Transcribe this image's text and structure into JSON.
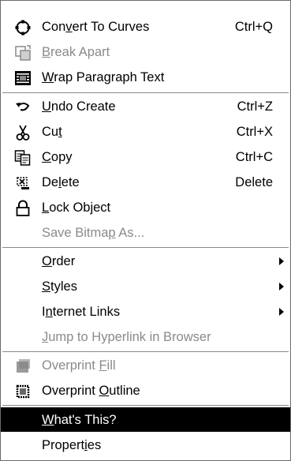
{
  "menu": {
    "items": [
      {
        "id": "convert",
        "label_pre": "Con",
        "label_u": "v",
        "label_post": "ert To Curves",
        "shortcut": "Ctrl+Q",
        "icon": "convert-curves-icon",
        "disabled": false
      },
      {
        "id": "break",
        "label_pre": "",
        "label_u": "B",
        "label_post": "reak  Apart",
        "shortcut": "",
        "icon": "break-apart-icon",
        "disabled": true
      },
      {
        "id": "wrap",
        "label_pre": "",
        "label_u": "W",
        "label_post": "rap Paragraph Text",
        "shortcut": "",
        "icon": "wrap-text-icon",
        "disabled": false
      },
      {
        "id": "undo",
        "label_pre": "",
        "label_u": "U",
        "label_post": "ndo Create",
        "shortcut": "Ctrl+Z",
        "icon": "undo-icon",
        "disabled": false
      },
      {
        "id": "cut",
        "label_pre": "Cu",
        "label_u": "t",
        "label_post": "",
        "shortcut": "Ctrl+X",
        "icon": "cut-icon",
        "disabled": false
      },
      {
        "id": "copy",
        "label_pre": "",
        "label_u": "C",
        "label_post": "opy",
        "shortcut": "Ctrl+C",
        "icon": "copy-icon",
        "disabled": false
      },
      {
        "id": "delete",
        "label_pre": "De",
        "label_u": "l",
        "label_post": "ete",
        "shortcut": "Delete",
        "icon": "delete-icon",
        "disabled": false
      },
      {
        "id": "lock",
        "label_pre": "",
        "label_u": "L",
        "label_post": "ock Object",
        "shortcut": "",
        "icon": "lock-icon",
        "disabled": false
      },
      {
        "id": "savebmp",
        "label_pre": "Save Bitma",
        "label_u": "p",
        "label_post": " As...",
        "shortcut": "",
        "icon": "",
        "disabled": true
      },
      {
        "id": "order",
        "label_pre": "",
        "label_u": "O",
        "label_post": "rder",
        "shortcut": "",
        "icon": "",
        "disabled": false,
        "submenu": true
      },
      {
        "id": "styles",
        "label_pre": "",
        "label_u": "S",
        "label_post": "tyles",
        "shortcut": "",
        "icon": "",
        "disabled": false,
        "submenu": true
      },
      {
        "id": "links",
        "label_pre": "I",
        "label_u": "n",
        "label_post": "ternet Links",
        "shortcut": "",
        "icon": "",
        "disabled": false,
        "submenu": true
      },
      {
        "id": "jump",
        "label_pre": "",
        "label_u": "J",
        "label_post": "ump to Hyperlink in Browser",
        "shortcut": "",
        "icon": "",
        "disabled": true
      },
      {
        "id": "ovfill",
        "label_pre": "Overprint ",
        "label_u": "F",
        "label_post": "ill",
        "shortcut": "",
        "icon": "overprint-fill-icon",
        "disabled": true
      },
      {
        "id": "ovoutline",
        "label_pre": "Overprint ",
        "label_u": "O",
        "label_post": "utline",
        "shortcut": "",
        "icon": "overprint-outline-icon",
        "disabled": false
      },
      {
        "id": "whatsthis",
        "label_pre": "",
        "label_u": "W",
        "label_post": "hat's This?",
        "shortcut": "",
        "icon": "",
        "disabled": false,
        "selected": true
      },
      {
        "id": "properties",
        "label_pre": "Propert",
        "label_u": "i",
        "label_post": "es",
        "shortcut": "",
        "icon": "",
        "disabled": false
      }
    ]
  },
  "colors": {
    "selected_bg": "#000000",
    "disabled_text": "#8a8a8a",
    "separator": "#8a8a8a"
  }
}
